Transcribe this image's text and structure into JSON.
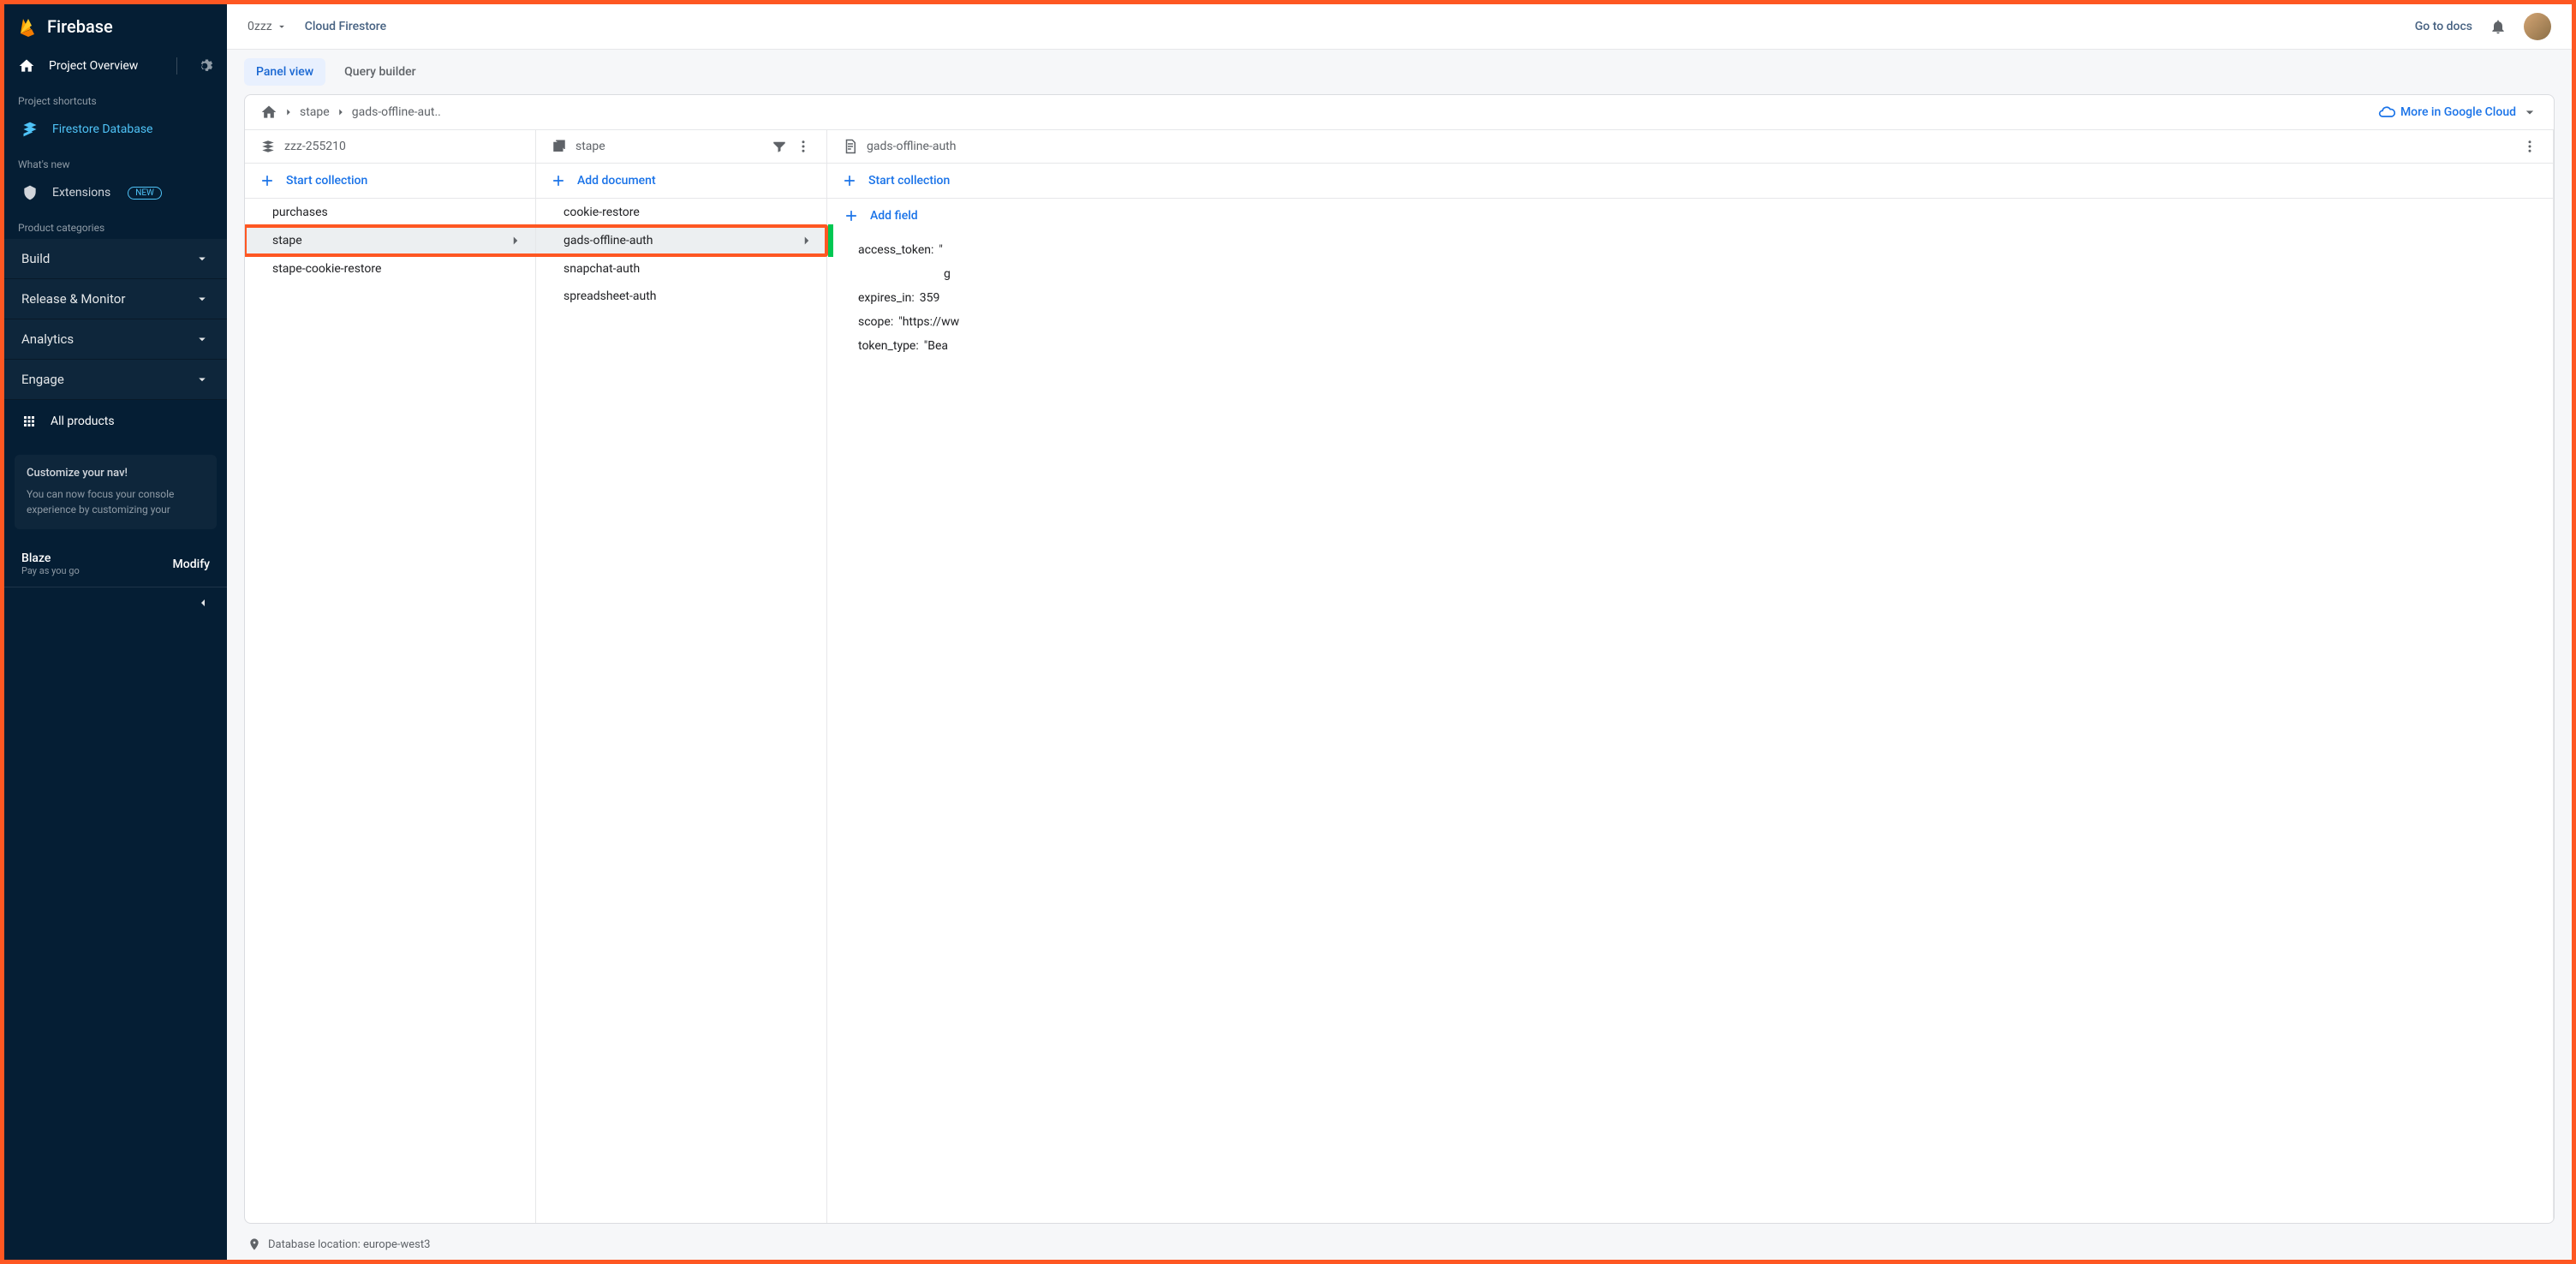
{
  "brand": "Firebase",
  "sidebar": {
    "overview": "Project Overview",
    "section_shortcuts": "Project shortcuts",
    "firestore_db": "Firestore Database",
    "section_whatsnew": "What's new",
    "extensions": "Extensions",
    "extensions_badge": "NEW",
    "section_categories": "Product categories",
    "cats": [
      "Build",
      "Release & Monitor",
      "Analytics",
      "Engage"
    ],
    "all_products": "All products",
    "promo_title": "Customize your nav!",
    "promo_body": "You can now focus your console experience by customizing your",
    "plan": "Blaze",
    "plan_sub": "Pay as you go",
    "modify": "Modify"
  },
  "topbar": {
    "project": "0zzz",
    "title": "Cloud Firestore",
    "docs": "Go to docs"
  },
  "tabs": {
    "panel": "Panel view",
    "query": "Query builder"
  },
  "breadcrumb": {
    "c1": "stape",
    "c2": "gads-offline-aut..",
    "cloud": "More in Google Cloud"
  },
  "col1": {
    "header": "zzz-255210",
    "start": "Start collection",
    "items": [
      "purchases",
      "stape",
      "stape-cookie-restore"
    ],
    "selected_index": 1
  },
  "col2": {
    "header": "stape",
    "add": "Add document",
    "items": [
      "cookie-restore",
      "gads-offline-auth",
      "snapchat-auth",
      "spreadsheet-auth"
    ],
    "selected_index": 1
  },
  "col3": {
    "header": "gads-offline-auth",
    "start": "Start collection",
    "addfield": "Add field",
    "fields": [
      {
        "key": "access_token:",
        "val": "\"",
        "extra": "g"
      },
      {
        "key": "expires_in:",
        "val": "359"
      },
      {
        "key": "scope:",
        "val": "\"https://ww"
      },
      {
        "key": "token_type:",
        "val": "\"Bea"
      }
    ]
  },
  "footer": {
    "loc": "Database location: europe-west3"
  }
}
